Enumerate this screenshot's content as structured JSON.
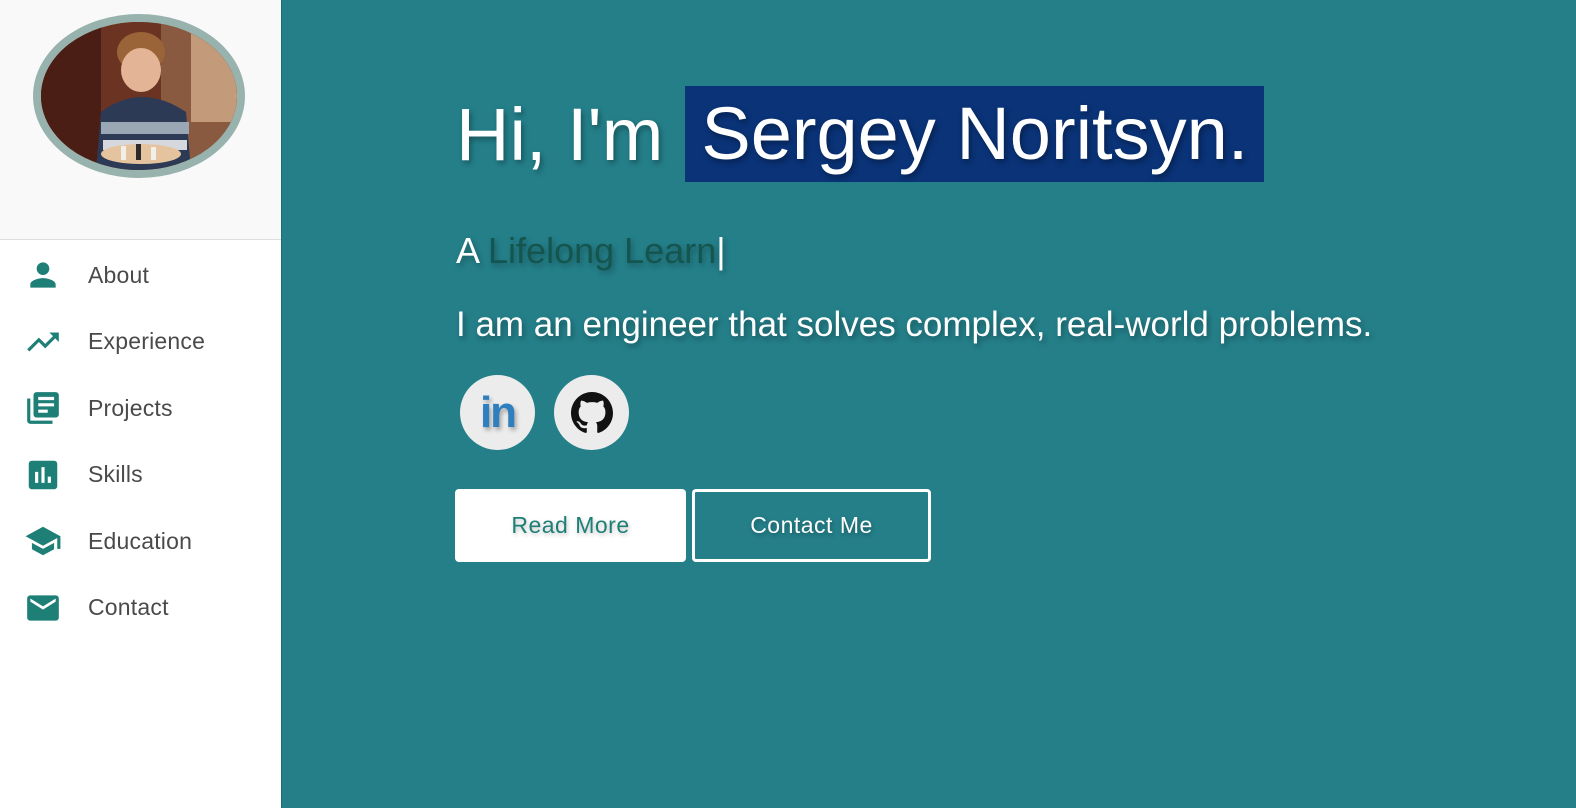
{
  "sidebar": {
    "items": [
      {
        "label": "About",
        "icon": "person-icon"
      },
      {
        "label": "Experience",
        "icon": "trending-up-icon"
      },
      {
        "label": "Projects",
        "icon": "library-books-icon"
      },
      {
        "label": "Skills",
        "icon": "bar-chart-icon"
      },
      {
        "label": "Education",
        "icon": "graduation-cap-icon"
      },
      {
        "label": "Contact",
        "icon": "mail-icon"
      }
    ]
  },
  "hero": {
    "greeting": "Hi, I'm",
    "name": "Sergey Noritsyn.",
    "tagline_prefix": "A ",
    "tagline_typed": "Lifelong Learn",
    "tagline_cursor": "|",
    "intro": "I am an engineer that solves complex, real-world problems.",
    "linkedin_text": "in",
    "buttons": {
      "read_more": "Read More",
      "contact_me": "Contact Me"
    }
  },
  "colors": {
    "background": "#247f89",
    "accent": "#1e7f77",
    "name_highlight": "#0a3378",
    "linkedin_blue": "#2f7fbf"
  }
}
